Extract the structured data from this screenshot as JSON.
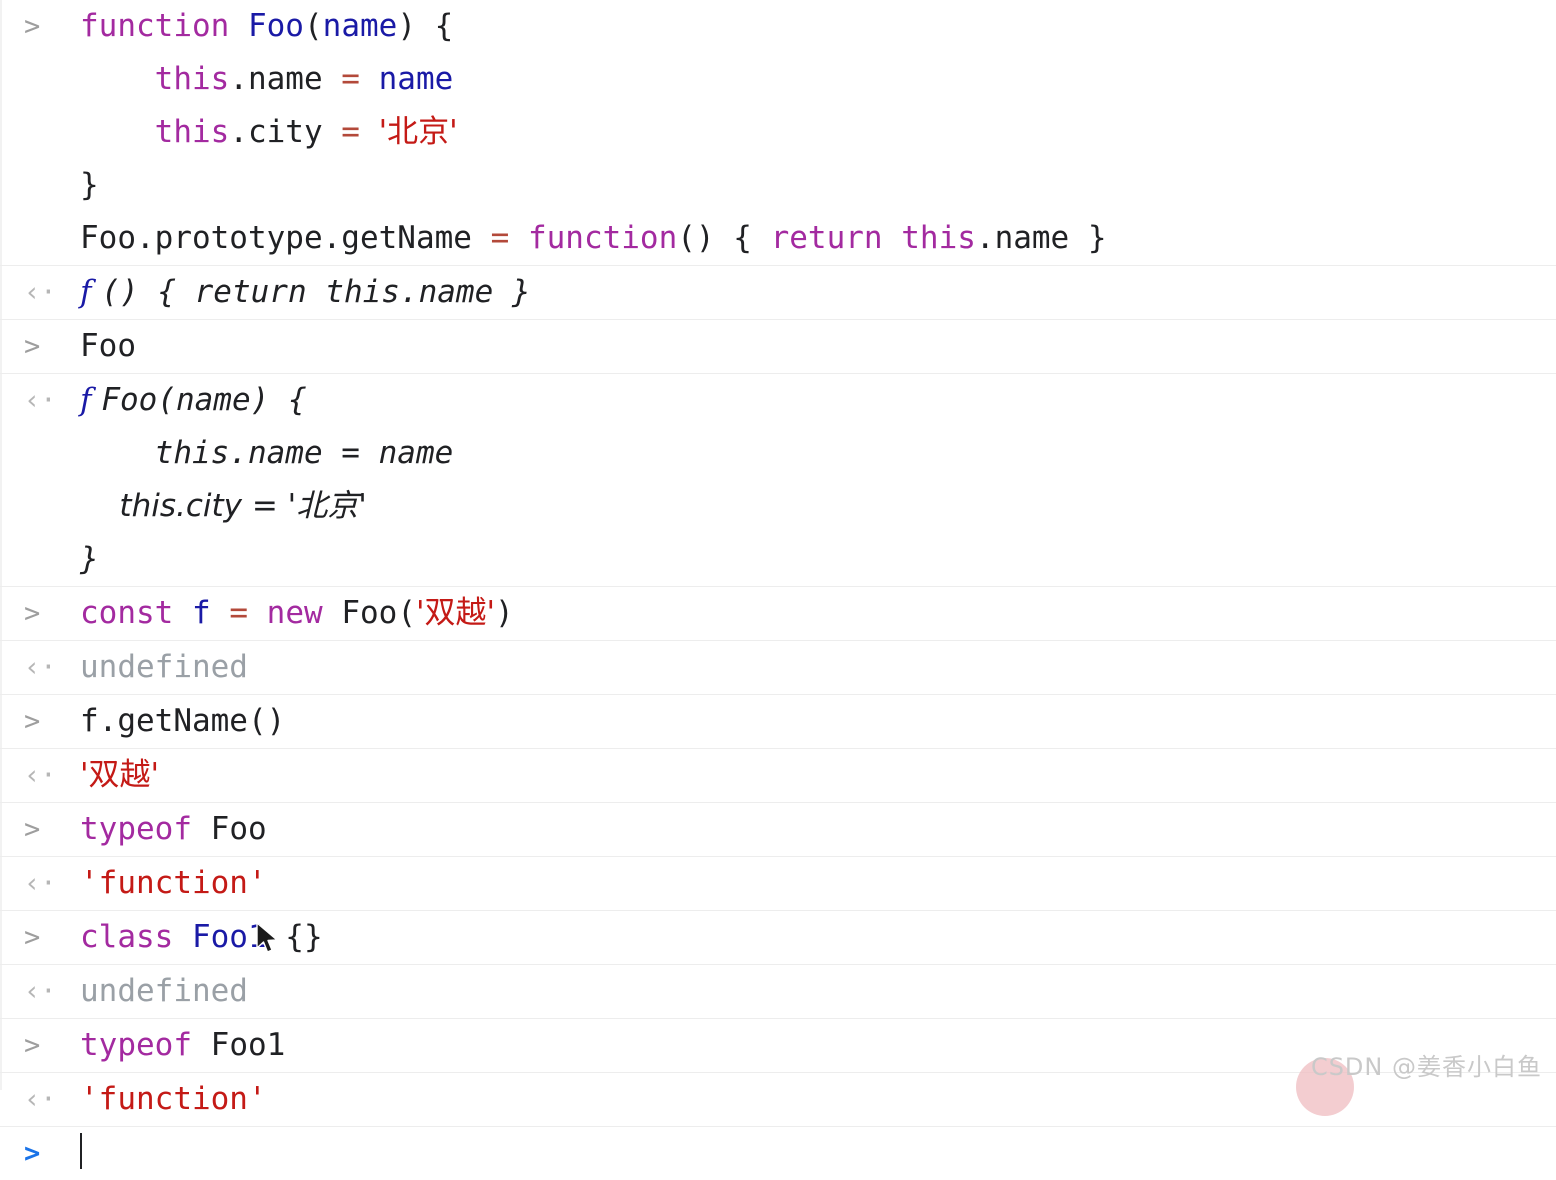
{
  "app": {
    "name": "chrome-devtools-console",
    "background": "#ffffff",
    "divider_color": "#ededed"
  },
  "markers": {
    "input": ">",
    "output": "‹·",
    "prompt_active": ">",
    "function_glyph": "f"
  },
  "colors": {
    "keyword": "#a32aa0",
    "identifier": "#1a1aa6",
    "operator": "#b3493a",
    "string": "#c41a16",
    "plain": "#202124",
    "muted": "#9aa0a6",
    "marker": "#a0a0a0",
    "active_marker": "#1a73e8"
  },
  "entries": [
    {
      "kind": "input",
      "name": "entry-define-foo",
      "lines": [
        [
          {
            "t": "function ",
            "c": "kw"
          },
          {
            "t": "Foo",
            "c": "fnname"
          },
          {
            "t": "(",
            "c": "plain"
          },
          {
            "t": "name",
            "c": "ident"
          },
          {
            "t": ") {",
            "c": "plain"
          }
        ],
        [
          {
            "t": "    ",
            "c": "plain"
          },
          {
            "t": "this",
            "c": "kw"
          },
          {
            "t": ".name ",
            "c": "plain"
          },
          {
            "t": "=",
            "c": "op"
          },
          {
            "t": " ",
            "c": "plain"
          },
          {
            "t": "name",
            "c": "ident"
          }
        ],
        [
          {
            "t": "    ",
            "c": "plain"
          },
          {
            "t": "this",
            "c": "kw"
          },
          {
            "t": ".city ",
            "c": "plain"
          },
          {
            "t": "=",
            "c": "op"
          },
          {
            "t": " ",
            "c": "plain"
          },
          {
            "t": "'北京'",
            "c": "str"
          }
        ],
        [
          {
            "t": "}",
            "c": "plain"
          }
        ],
        [
          {
            "t": "Foo.prototype.getName ",
            "c": "plain"
          },
          {
            "t": "=",
            "c": "op"
          },
          {
            "t": " ",
            "c": "plain"
          },
          {
            "t": "function",
            "c": "kw"
          },
          {
            "t": "() { ",
            "c": "plain"
          },
          {
            "t": "return ",
            "c": "kw"
          },
          {
            "t": "this",
            "c": "kw"
          },
          {
            "t": ".name }",
            "c": "plain"
          }
        ]
      ]
    },
    {
      "kind": "output",
      "name": "entry-define-foo-result",
      "preview": true,
      "fglyph": true,
      "lines": [
        [
          {
            "t": "() { return this.name }",
            "c": "plain"
          }
        ]
      ]
    },
    {
      "kind": "input",
      "name": "entry-eval-foo",
      "lines": [
        [
          {
            "t": "Foo",
            "c": "plain"
          }
        ]
      ]
    },
    {
      "kind": "output",
      "name": "entry-eval-foo-result",
      "preview": true,
      "fglyph": true,
      "lines": [
        [
          {
            "t": "Foo(name) {",
            "c": "plain"
          }
        ],
        [
          {
            "t": "    this.name = name",
            "c": "plain"
          }
        ],
        [
          {
            "t": "    this.city = '北京'",
            "c": "plain"
          }
        ],
        [
          {
            "t": "}",
            "c": "plain"
          }
        ]
      ]
    },
    {
      "kind": "input",
      "name": "entry-const-f",
      "lines": [
        [
          {
            "t": "const ",
            "c": "kw"
          },
          {
            "t": "f",
            "c": "ident"
          },
          {
            "t": " ",
            "c": "plain"
          },
          {
            "t": "=",
            "c": "op"
          },
          {
            "t": " ",
            "c": "plain"
          },
          {
            "t": "new ",
            "c": "kw"
          },
          {
            "t": "Foo(",
            "c": "plain"
          },
          {
            "t": "'双越'",
            "c": "str"
          },
          {
            "t": ")",
            "c": "plain"
          }
        ]
      ]
    },
    {
      "kind": "output",
      "name": "entry-const-f-result",
      "lines": [
        [
          {
            "t": "undefined",
            "c": "muted"
          }
        ]
      ]
    },
    {
      "kind": "input",
      "name": "entry-getname-call",
      "lines": [
        [
          {
            "t": "f.getName()",
            "c": "plain"
          }
        ]
      ]
    },
    {
      "kind": "output",
      "name": "entry-getname-result",
      "lines": [
        [
          {
            "t": "'双越'",
            "c": "str"
          }
        ]
      ]
    },
    {
      "kind": "input",
      "name": "entry-typeof-foo",
      "lines": [
        [
          {
            "t": "typeof ",
            "c": "kw"
          },
          {
            "t": "Foo",
            "c": "plain"
          }
        ]
      ]
    },
    {
      "kind": "output",
      "name": "entry-typeof-foo-result",
      "lines": [
        [
          {
            "t": "'function'",
            "c": "str"
          }
        ]
      ]
    },
    {
      "kind": "input",
      "name": "entry-class-foo1",
      "lines": [
        [
          {
            "t": "class ",
            "c": "kw"
          },
          {
            "t": "Foo1",
            "c": "fnname"
          },
          {
            "t": " {}",
            "c": "plain"
          }
        ]
      ]
    },
    {
      "kind": "output",
      "name": "entry-class-foo1-result",
      "lines": [
        [
          {
            "t": "undefined",
            "c": "muted"
          }
        ]
      ]
    },
    {
      "kind": "input",
      "name": "entry-typeof-foo1",
      "lines": [
        [
          {
            "t": "typeof ",
            "c": "kw"
          },
          {
            "t": "Foo1",
            "c": "plain"
          }
        ]
      ]
    },
    {
      "kind": "output",
      "name": "entry-typeof-foo1-result",
      "lines": [
        [
          {
            "t": "'function'",
            "c": "str"
          }
        ]
      ]
    }
  ],
  "prompt": {
    "marker": ">",
    "value": "",
    "placeholder": ""
  },
  "watermark": {
    "text": "CSDN @姜香小白鱼"
  }
}
